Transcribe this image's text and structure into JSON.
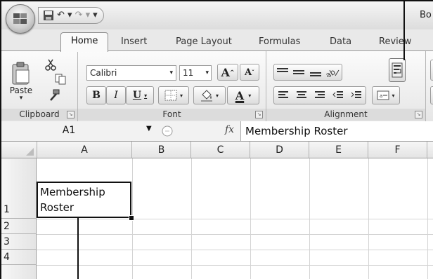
{
  "window": {
    "title": "Bo"
  },
  "quick_access": {
    "save_icon": "save-icon",
    "undo_glyph": "↶ ▾",
    "redo_glyph": "↷ ▾",
    "customize_glyph": "▾"
  },
  "tabs": [
    {
      "label": "Home",
      "active": true
    },
    {
      "label": "Insert"
    },
    {
      "label": "Page Layout"
    },
    {
      "label": "Formulas"
    },
    {
      "label": "Data"
    },
    {
      "label": "Review"
    }
  ],
  "ribbon": {
    "clipboard": {
      "label": "Clipboard",
      "paste": "Paste",
      "paste_arrow": "▾"
    },
    "font": {
      "label": "Font",
      "font_name": "Calibri",
      "font_size": "11",
      "grow": "A",
      "shrink": "A",
      "bold": "B",
      "italic": "I",
      "underline": "U",
      "font_color_letter": "A"
    },
    "alignment": {
      "label": "Alignment"
    }
  },
  "formula_bar": {
    "name_box": "A1",
    "fx": "fx",
    "content": "Membership Roster"
  },
  "sheet": {
    "columns": [
      "A",
      "B",
      "C",
      "D",
      "E",
      "F"
    ],
    "rows": [
      "1",
      "2",
      "3",
      "4"
    ],
    "a1_text": "Membership\nRoster"
  }
}
